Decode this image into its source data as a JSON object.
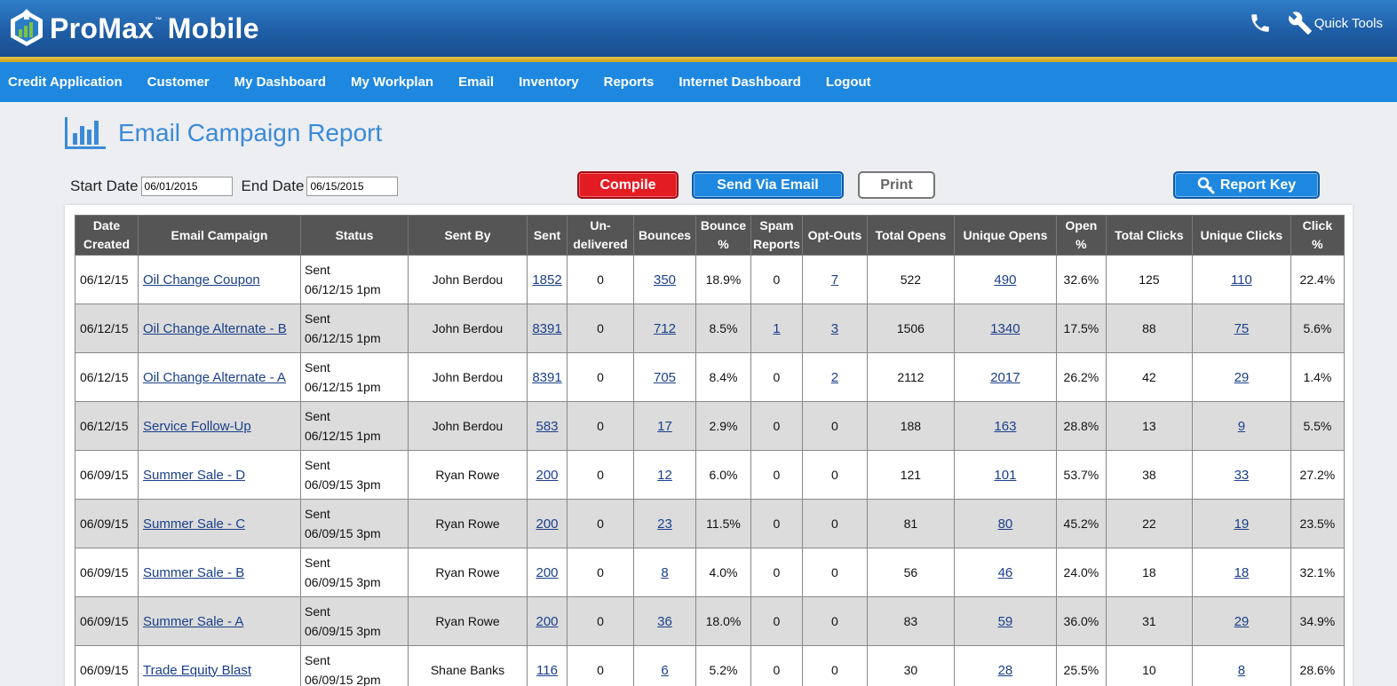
{
  "header": {
    "logo_text": "ProMax",
    "logo_tm": "™",
    "logo_text2": "Mobile",
    "quick_tools_label": "Quick Tools",
    "brand_color": "#1e88e0"
  },
  "nav": {
    "items": [
      "Credit Application",
      "Customer",
      "My Dashboard",
      "My Workplan",
      "Email",
      "Inventory",
      "Reports",
      "Internet Dashboard",
      "Logout"
    ]
  },
  "page": {
    "title": "Email Campaign Report"
  },
  "filters": {
    "start_label": "Start Date",
    "start_value": "06/01/2015",
    "end_label": "End Date",
    "end_value": "06/15/2015"
  },
  "buttons": {
    "compile": "Compile",
    "send_email": "Send Via Email",
    "print": "Print",
    "report_key": "Report Key"
  },
  "table": {
    "columns": [
      [
        "Date",
        "Created"
      ],
      [
        "Email Campaign"
      ],
      [
        "Status"
      ],
      [
        "Sent By"
      ],
      [
        "Sent"
      ],
      [
        "Un-",
        "delivered"
      ],
      [
        "Bounces"
      ],
      [
        "Bounce",
        "%"
      ],
      [
        "Spam",
        "Reports"
      ],
      [
        "Opt-Outs"
      ],
      [
        "Total Opens"
      ],
      [
        "Unique Opens"
      ],
      [
        "Open",
        "%"
      ],
      [
        "Total Clicks"
      ],
      [
        "Unique Clicks"
      ],
      [
        "Click",
        "%"
      ]
    ],
    "rows": [
      {
        "date": "06/12/15",
        "campaign": "Oil Change Coupon",
        "status1": "Sent",
        "status2": "06/12/15 1pm",
        "sent_by": "John Berdou",
        "sent": "1852",
        "undelivered": "0",
        "bounces": "350",
        "bounce_pct": "18.9%",
        "spam": "0",
        "spam_link": false,
        "optouts": "7",
        "optouts_link": true,
        "total_opens": "522",
        "unique_opens": "490",
        "open_pct": "32.6%",
        "total_clicks": "125",
        "unique_clicks": "110",
        "click_pct": "22.4%"
      },
      {
        "date": "06/12/15",
        "campaign": "Oil Change Alternate - B",
        "status1": "Sent",
        "status2": "06/12/15 1pm",
        "sent_by": "John Berdou",
        "sent": "8391",
        "undelivered": "0",
        "bounces": "712",
        "bounce_pct": "8.5%",
        "spam": "1",
        "spam_link": true,
        "optouts": "3",
        "optouts_link": true,
        "total_opens": "1506",
        "unique_opens": "1340",
        "open_pct": "17.5%",
        "total_clicks": "88",
        "unique_clicks": "75",
        "click_pct": "5.6%"
      },
      {
        "date": "06/12/15",
        "campaign": "Oil Change Alternate - A",
        "status1": "Sent",
        "status2": "06/12/15 1pm",
        "sent_by": "John Berdou",
        "sent": "8391",
        "undelivered": "0",
        "bounces": "705",
        "bounce_pct": "8.4%",
        "spam": "0",
        "spam_link": false,
        "optouts": "2",
        "optouts_link": true,
        "total_opens": "2112",
        "unique_opens": "2017",
        "open_pct": "26.2%",
        "total_clicks": "42",
        "unique_clicks": "29",
        "click_pct": "1.4%"
      },
      {
        "date": "06/12/15",
        "campaign": "Service Follow-Up",
        "status1": "Sent",
        "status2": "06/12/15 1pm",
        "sent_by": "John Berdou",
        "sent": "583",
        "undelivered": "0",
        "bounces": "17",
        "bounce_pct": "2.9%",
        "spam": "0",
        "spam_link": false,
        "optouts": "0",
        "optouts_link": false,
        "total_opens": "188",
        "unique_opens": "163",
        "open_pct": "28.8%",
        "total_clicks": "13",
        "unique_clicks": "9",
        "click_pct": "5.5%"
      },
      {
        "date": "06/09/15",
        "campaign": "Summer Sale - D",
        "status1": "Sent",
        "status2": "06/09/15 3pm",
        "sent_by": "Ryan Rowe",
        "sent": "200",
        "undelivered": "0",
        "bounces": "12",
        "bounce_pct": "6.0%",
        "spam": "0",
        "spam_link": false,
        "optouts": "0",
        "optouts_link": false,
        "total_opens": "121",
        "unique_opens": "101",
        "open_pct": "53.7%",
        "total_clicks": "38",
        "unique_clicks": "33",
        "click_pct": "27.2%"
      },
      {
        "date": "06/09/15",
        "campaign": "Summer Sale - C",
        "status1": "Sent",
        "status2": "06/09/15 3pm",
        "sent_by": "Ryan Rowe",
        "sent": "200",
        "undelivered": "0",
        "bounces": "23",
        "bounce_pct": "11.5%",
        "spam": "0",
        "spam_link": false,
        "optouts": "0",
        "optouts_link": false,
        "total_opens": "81",
        "unique_opens": "80",
        "open_pct": "45.2%",
        "total_clicks": "22",
        "unique_clicks": "19",
        "click_pct": "23.5%"
      },
      {
        "date": "06/09/15",
        "campaign": "Summer Sale - B",
        "status1": "Sent",
        "status2": "06/09/15 3pm",
        "sent_by": "Ryan Rowe",
        "sent": "200",
        "undelivered": "0",
        "bounces": "8",
        "bounce_pct": "4.0%",
        "spam": "0",
        "spam_link": false,
        "optouts": "0",
        "optouts_link": false,
        "total_opens": "56",
        "unique_opens": "46",
        "open_pct": "24.0%",
        "total_clicks": "18",
        "unique_clicks": "18",
        "click_pct": "32.1%"
      },
      {
        "date": "06/09/15",
        "campaign": "Summer Sale - A",
        "status1": "Sent",
        "status2": "06/09/15 3pm",
        "sent_by": "Ryan Rowe",
        "sent": "200",
        "undelivered": "0",
        "bounces": "36",
        "bounce_pct": "18.0%",
        "spam": "0",
        "spam_link": false,
        "optouts": "0",
        "optouts_link": false,
        "total_opens": "83",
        "unique_opens": "59",
        "open_pct": "36.0%",
        "total_clicks": "31",
        "unique_clicks": "29",
        "click_pct": "34.9%"
      },
      {
        "date": "06/09/15",
        "campaign": "Trade Equity Blast",
        "status1": "Sent",
        "status2": "06/09/15 2pm",
        "sent_by": "Shane Banks",
        "sent": "116",
        "undelivered": "0",
        "bounces": "6",
        "bounce_pct": "5.2%",
        "spam": "0",
        "spam_link": false,
        "optouts": "0",
        "optouts_link": false,
        "total_opens": "30",
        "unique_opens": "28",
        "open_pct": "25.5%",
        "total_clicks": "10",
        "unique_clicks": "8",
        "click_pct": "28.6%"
      }
    ]
  }
}
